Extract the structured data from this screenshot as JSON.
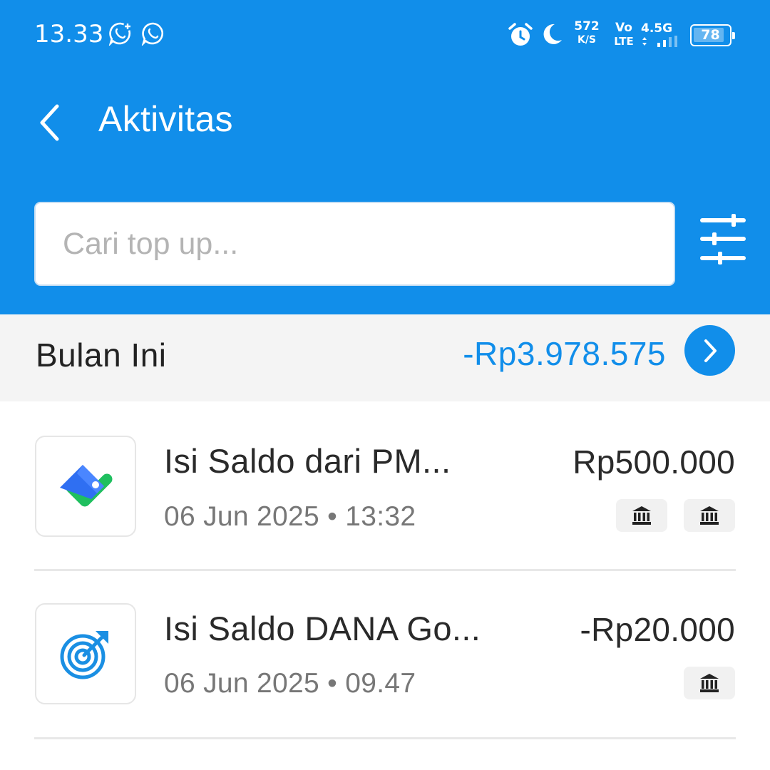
{
  "status_bar": {
    "time": "13.33",
    "net_speed_value": "572",
    "net_speed_unit": "K/S",
    "volte_top": "Vo",
    "volte_bottom": "LTE",
    "network_type": "4.5G",
    "battery_level": "78",
    "icons": [
      "whatsapp-business-icon",
      "whatsapp-icon",
      "alarm-icon",
      "moon-icon",
      "signal-icon",
      "battery-icon"
    ]
  },
  "header": {
    "title": "Aktivitas",
    "background_color": "#118eea"
  },
  "search": {
    "placeholder": "Cari top up..."
  },
  "summary": {
    "label": "Bulan Ini",
    "total": "-Rp3.978.575",
    "accent_color": "#118eea"
  },
  "transactions": [
    {
      "title": "Isi Saldo dari PM...",
      "date": "06 Jun 2025",
      "time": "13:32",
      "meta": "06 Jun 2025 • 13:32",
      "amount": "Rp500.000",
      "icon": "wallet-topup-icon",
      "badges": [
        "bank-icon",
        "bank-icon"
      ]
    },
    {
      "title": "Isi Saldo DANA Go...",
      "date": "06 Jun 2025",
      "time": "09.47",
      "meta": "06 Jun 2025 • 09.47",
      "amount": "-Rp20.000",
      "icon": "target-goal-icon",
      "badges": [
        "bank-icon"
      ]
    }
  ]
}
